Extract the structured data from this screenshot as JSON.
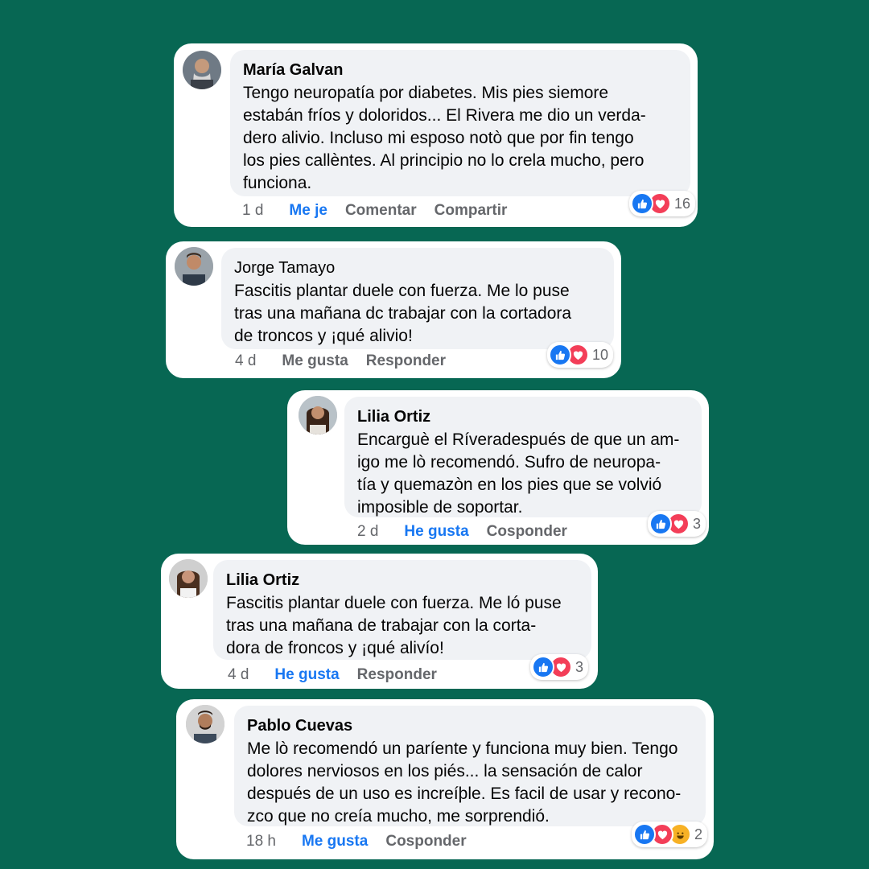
{
  "colors": {
    "background": "#076753",
    "accent_blue": "#1877f2",
    "love_red": "#f33e58",
    "haha_yellow": "#f7b125"
  },
  "comments": [
    {
      "author": "María Galvan",
      "text": "Tengo neuropatía por diabetes. Mis pies siemore\nestabán fríos y doloridos... El Rivera me dio un verda-\ndero alivio. Incluso mi esposo notò que por fin tengo\nlos pies callèntes. Al principio no lo crela mucho, pero\nfunciona.",
      "time": "1 d",
      "like_label": "Me je",
      "reply_label": "Comentar",
      "share_label": "Compartir",
      "reactions": [
        "like-icon",
        "love-icon"
      ],
      "reaction_count": "16"
    },
    {
      "author": "Jorge Tamayo",
      "text": "Fascitis plantar duele con fuerza. Me lo puse\ntras una mañana dc trabajar con la cortadora\nde troncos y ¡qué alivio!",
      "time": "4 d",
      "like_label": "Me gusta",
      "reply_label": "Responder",
      "reactions": [
        "like-icon",
        "love-icon"
      ],
      "reaction_count": "10"
    },
    {
      "author": "Lilia Ortiz",
      "text": "Encarguè el  Ríveradespués de que un am-\nigo me lò recomendó. Sufro de neuropa-\ntía y quemazòn en los pies que se volvió\nimposible de soportar.",
      "time": "2 d",
      "like_label": "He gusta",
      "reply_label": "Cosponder",
      "reactions": [
        "like-icon",
        "love-icon"
      ],
      "reaction_count": "3"
    },
    {
      "author": "Lilia Ortiz",
      "text": "Fascitis plantar duele con fuerza. Me ló puse\ntras una mañana de trabajar con la corta-\ndora de froncos y ¡qué alivío!",
      "time": "4 d",
      "like_label": "He gusta",
      "reply_label": "Responder",
      "reactions": [
        "like-icon",
        "love-icon"
      ],
      "reaction_count": "3"
    },
    {
      "author": "Pablo Cuevas",
      "text": "Me lò recomendó un paríente y funciona muy bien. Tengo\ndolores nerviosos en los piés... la sensación de calor\ndespués de un uso es increíþle. Es facil de usar y recono-\nzco que no creía mucho, me sorprendió.",
      "time": "18 h",
      "like_label": "Me gusta",
      "reply_label": "Cosponder",
      "reactions": [
        "like-icon",
        "love-icon",
        "haha-icon"
      ],
      "reaction_count": "2"
    }
  ]
}
